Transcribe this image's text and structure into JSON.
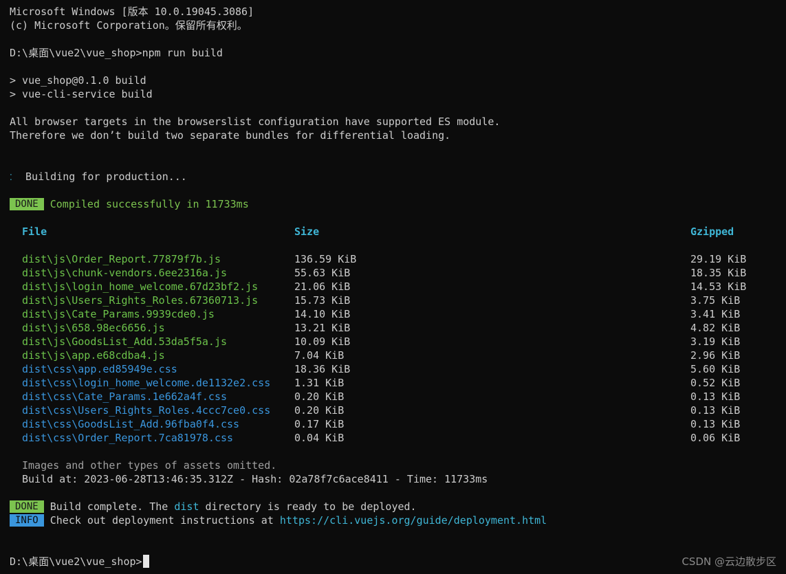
{
  "header": {
    "line1": "Microsoft Windows [版本 10.0.19045.3086]",
    "line2": "(c) Microsoft Corporation。保留所有权利。"
  },
  "command": {
    "prompt": "D:\\桌面\\vue2\\vue_shop>",
    "text": "npm run build"
  },
  "script_lines": [
    "> vue_shop@0.1.0 build",
    "> vue-cli-service build"
  ],
  "notice_lines": [
    "All browser targets in the browserslist configuration have supported ES module.",
    "Therefore we don’t build two separate bundles for differential loading."
  ],
  "building": {
    "spinner_icon": "spinner-icon",
    "text": "Building for production..."
  },
  "compiled": {
    "badge": "DONE",
    "text": "Compiled successfully in 11733ms"
  },
  "table": {
    "headers": {
      "file": "File",
      "size": "Size",
      "gzipped": "Gzipped"
    },
    "rows": [
      {
        "file": "dist\\js\\Order_Report.77879f7b.js",
        "size": "136.59 KiB",
        "gzipped": "29.19 KiB",
        "kind": "js"
      },
      {
        "file": "dist\\js\\chunk-vendors.6ee2316a.js",
        "size": "55.63 KiB",
        "gzipped": "18.35 KiB",
        "kind": "js"
      },
      {
        "file": "dist\\js\\login_home_welcome.67d23bf2.js",
        "size": "21.06 KiB",
        "gzipped": "14.53 KiB",
        "kind": "js"
      },
      {
        "file": "dist\\js\\Users_Rights_Roles.67360713.js",
        "size": "15.73 KiB",
        "gzipped": "3.75 KiB",
        "kind": "js"
      },
      {
        "file": "dist\\js\\Cate_Params.9939cde0.js",
        "size": "14.10 KiB",
        "gzipped": "3.41 KiB",
        "kind": "js"
      },
      {
        "file": "dist\\js\\658.98ec6656.js",
        "size": "13.21 KiB",
        "gzipped": "4.82 KiB",
        "kind": "js"
      },
      {
        "file": "dist\\js\\GoodsList_Add.53da5f5a.js",
        "size": "10.09 KiB",
        "gzipped": "3.19 KiB",
        "kind": "js"
      },
      {
        "file": "dist\\js\\app.e68cdba4.js",
        "size": "7.04 KiB",
        "gzipped": "2.96 KiB",
        "kind": "js"
      },
      {
        "file": "dist\\css\\app.ed85949e.css",
        "size": "18.36 KiB",
        "gzipped": "5.60 KiB",
        "kind": "css"
      },
      {
        "file": "dist\\css\\login_home_welcome.de1132e2.css",
        "size": "1.31 KiB",
        "gzipped": "0.52 KiB",
        "kind": "css"
      },
      {
        "file": "dist\\css\\Cate_Params.1e662a4f.css",
        "size": "0.20 KiB",
        "gzipped": "0.13 KiB",
        "kind": "css"
      },
      {
        "file": "dist\\css\\Users_Rights_Roles.4ccc7ce0.css",
        "size": "0.20 KiB",
        "gzipped": "0.13 KiB",
        "kind": "css"
      },
      {
        "file": "dist\\css\\GoodsList_Add.96fba0f4.css",
        "size": "0.17 KiB",
        "gzipped": "0.13 KiB",
        "kind": "css"
      },
      {
        "file": "dist\\css\\Order_Report.7ca81978.css",
        "size": "0.04 KiB",
        "gzipped": "0.06 KiB",
        "kind": "css"
      }
    ]
  },
  "footer": {
    "omitted": "Images and other types of assets omitted.",
    "build_at": "Build at: 2023-06-28T13:46:35.312Z - Hash: 02a78f7c6ace8411 - Time: 11733ms"
  },
  "complete": {
    "badge": "DONE",
    "text_before": "Build complete. The ",
    "dist_word": "dist",
    "text_after": " directory is ready to be deployed."
  },
  "info": {
    "badge": "INFO",
    "text": "Check out deployment instructions at ",
    "link": "https://cli.vuejs.org/guide/deployment.html"
  },
  "final_prompt": "D:\\桌面\\vue2\\vue_shop>",
  "watermark": "CSDN @云边散步区",
  "colors": {
    "background": "#0c0c0c",
    "text": "#cccccc",
    "js_green": "#6cc24a",
    "css_blue": "#3a96dd",
    "header_cyan": "#3fb6d6",
    "done_badge": "#7cc34f",
    "info_badge": "#3a96dd"
  }
}
